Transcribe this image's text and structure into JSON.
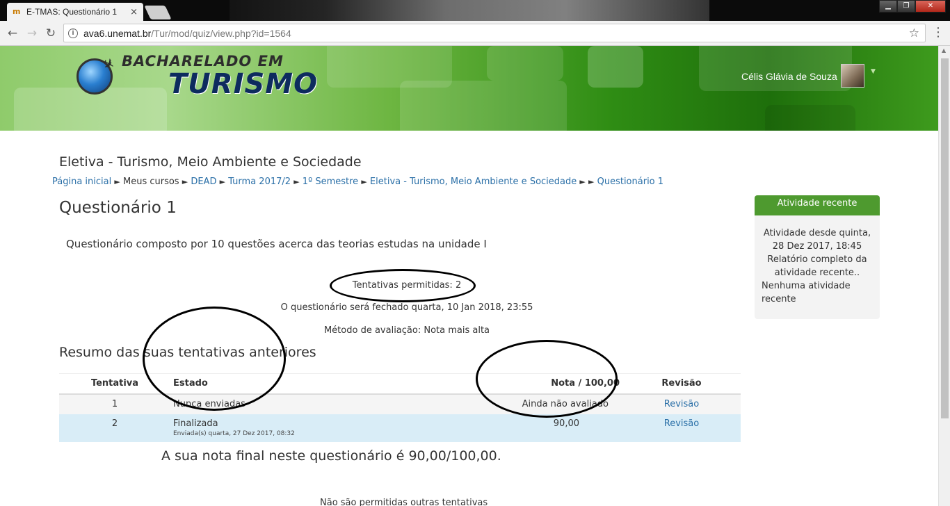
{
  "browser": {
    "tab_title": "E-TMAS: Questionário 1",
    "tab_close": "×",
    "url_host": "ava6.unemat.br",
    "url_path": "/Tur/mod/quiz/view.php?id=1564",
    "back": "←",
    "forward": "→",
    "reload": "↻",
    "star": "☆",
    "menu": "⋮",
    "win_minimize": "▁",
    "win_maximize": "❐",
    "win_close": "✕"
  },
  "header": {
    "logo_top": "BACHARELADO EM",
    "logo_main": "TURISMO",
    "user_name": "Célis Glávia de Souza"
  },
  "course_title": "Eletiva - Turismo, Meio Ambiente e Sociedade",
  "breadcrumb": {
    "home": "Página inicial",
    "my_courses": "Meus cursos",
    "dead": "DEAD",
    "turma": "Turma 2017/2",
    "semester": "1º Semestre",
    "course": "Eletiva - Turismo, Meio Ambiente e Sociedade",
    "quiz": "Questionário 1",
    "sep": "►"
  },
  "quiz": {
    "title": "Questionário 1",
    "intro": "Questionário composto por 10 questões acerca das teorias estudas na unidade I",
    "attempts_allowed": "Tentativas permitidas: 2",
    "close_date": "O questionário será fechado quarta, 10 Jan 2018, 23:55",
    "grading_method": "Método de avaliação: Nota mais alta",
    "summary_title": "Resumo das suas tentativas anteriores",
    "table": {
      "headers": [
        "Tentativa",
        "Estado",
        "Nota / 100,00",
        "Revisão"
      ],
      "rows": [
        {
          "attempt": "1",
          "state": "Nunca enviadas",
          "state_sub": "",
          "grade": "Ainda não avaliado",
          "review": "Revisão"
        },
        {
          "attempt": "2",
          "state": "Finalizada",
          "state_sub": "Enviada(s) quarta, 27 Dez 2017, 08:32",
          "grade": "90,00",
          "review": "Revisão"
        }
      ]
    },
    "final_grade": "A sua nota final neste questionário é 90,00/100,00.",
    "no_more_attempts": "Não são permitidas outras tentativas"
  },
  "recent_activity": {
    "title": "Atividade recente",
    "since": "Atividade desde quinta, 28 Dez 2017, 18:45",
    "full_report": "Relatório completo da atividade recente..",
    "none": "Nenhuma atividade recente"
  },
  "colors": {
    "link": "#2a6fa7",
    "block_header": "#4e9a2f",
    "highlight_row": "#d9edf7"
  }
}
